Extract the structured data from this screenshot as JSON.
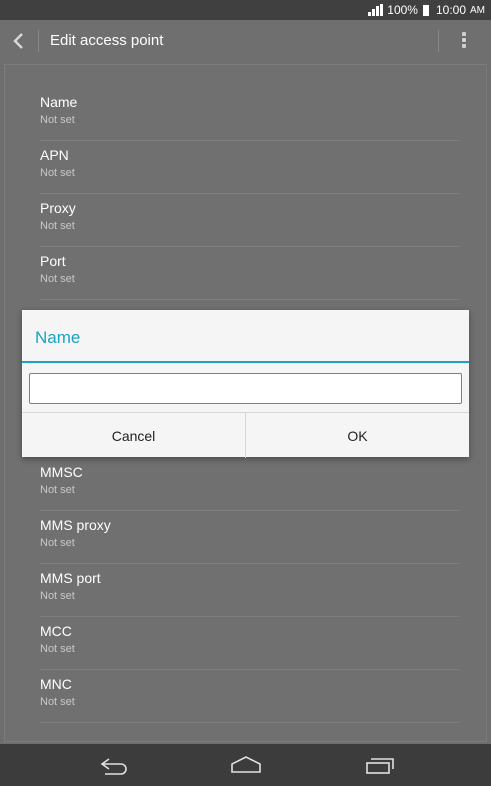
{
  "status_bar": {
    "battery": "100%",
    "time": "10:00",
    "ampm": "AM"
  },
  "app_bar": {
    "title": "Edit access point"
  },
  "settings": [
    {
      "title": "Name",
      "value": "Not set"
    },
    {
      "title": "APN",
      "value": "Not set"
    },
    {
      "title": "Proxy",
      "value": "Not set"
    },
    {
      "title": "Port",
      "value": "Not set"
    },
    {
      "title": "MMSC",
      "value": "Not set"
    },
    {
      "title": "MMS proxy",
      "value": "Not set"
    },
    {
      "title": "MMS port",
      "value": "Not set"
    },
    {
      "title": "MCC",
      "value": "Not set"
    },
    {
      "title": "MNC",
      "value": "Not set"
    }
  ],
  "dialog": {
    "title": "Name",
    "input_value": "",
    "cancel_label": "Cancel",
    "ok_label": "OK"
  },
  "colors": {
    "accent": "#1aa3c2"
  }
}
